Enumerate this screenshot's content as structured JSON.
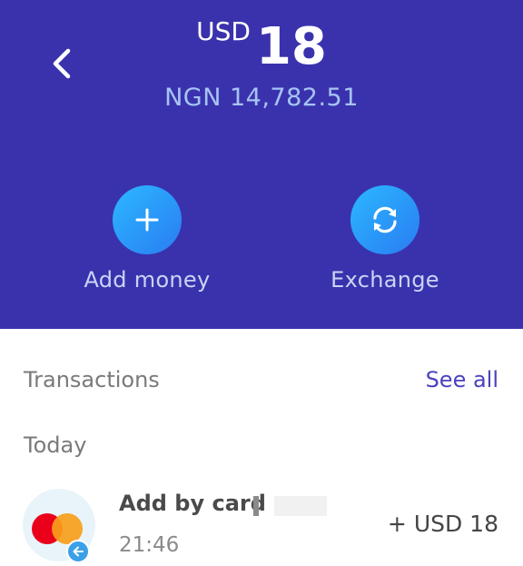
{
  "header": {
    "back_label": "Back",
    "balance_currency": "USD",
    "balance_amount": "18",
    "converted_balance": "NGN 14,782.51",
    "background_color": "#3a32ad"
  },
  "actions": [
    {
      "label": "Add money",
      "icon": "plus-icon"
    },
    {
      "label": "Exchange",
      "icon": "exchange-icon"
    }
  ],
  "transactions": {
    "title": "Transactions",
    "see_all_label": "See all",
    "groups": [
      {
        "label": "Today",
        "items": [
          {
            "title": "Add by card",
            "time": "21:46",
            "amount": "+ USD 18",
            "icon": "mastercard-icon",
            "badge_icon": "arrow-left-icon"
          }
        ]
      }
    ]
  }
}
